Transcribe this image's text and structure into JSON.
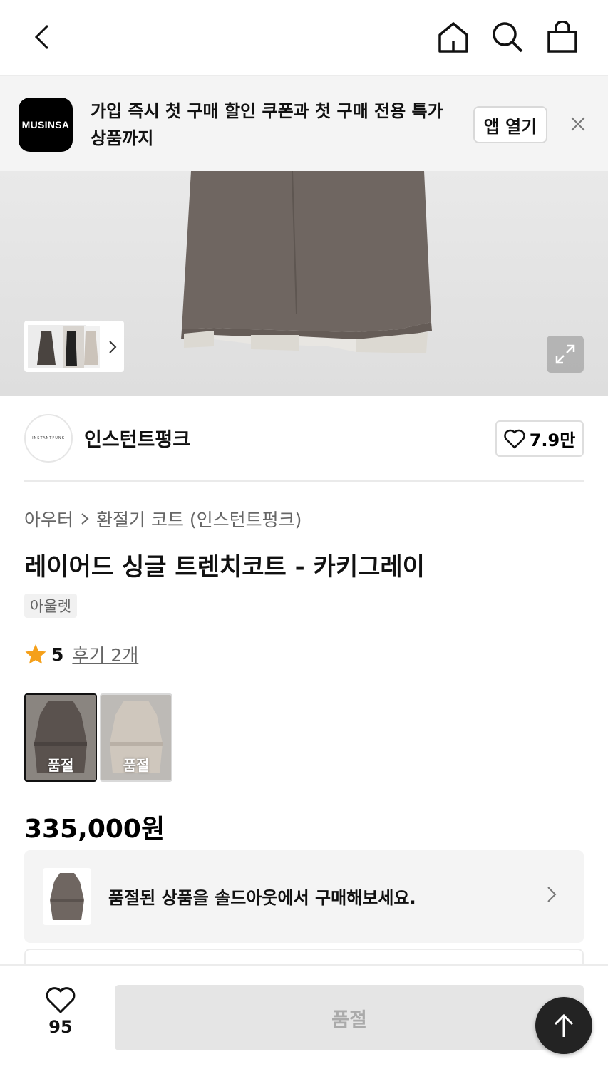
{
  "header": {
    "back_icon": "chevron-left-icon",
    "home_icon": "home-icon",
    "search_icon": "search-icon",
    "cart_icon": "shopping-bag-icon"
  },
  "app_banner": {
    "logo_text": "MUSINSA",
    "message": "가입 즉시 첫 구매 할인 쿠폰과 첫 구매 전용 특가 상품까지",
    "open_label": "앱 열기",
    "close_icon": "close-icon"
  },
  "gallery": {
    "expand_icon": "expand-icon",
    "thumbnail_more_icon": "chevron-right-icon"
  },
  "brand": {
    "logo_text": "INSTANTFUNK",
    "name": "인스턴트펑크",
    "like_count": "7.9만"
  },
  "breadcrumb": {
    "category": "아우터",
    "subcategory": "환절기 코트 (인스턴트펑크)"
  },
  "product": {
    "title": "레이어드 싱글 트렌치코트 - 카키그레이",
    "tag": "아울렛",
    "rating": "5",
    "reviews": "후기 2개",
    "price": "335,000원"
  },
  "options": [
    {
      "label": "품절",
      "color": "#6f6661",
      "selected": true
    },
    {
      "label": "품절",
      "color": "#d4ccc2",
      "selected": false
    }
  ],
  "soldout_notice": {
    "message": "품절된 상품을 솔드아웃에서 구매해보세요."
  },
  "bottom_bar": {
    "favorite_count": "95",
    "buy_label": "품절"
  },
  "colors": {
    "star": "#f5a01a",
    "coat_khaki_gray": "#6f6661",
    "coat_beige": "#d4ccc2"
  }
}
